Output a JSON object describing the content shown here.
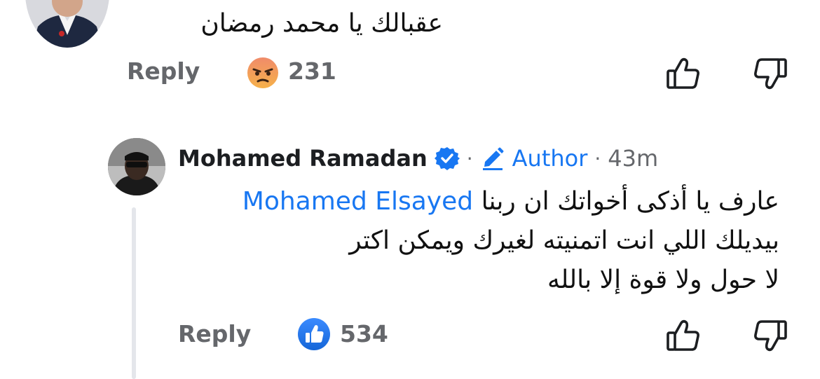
{
  "top_comment": {
    "text": "عقبالك يا محمد رمضان",
    "reply_label": "Reply",
    "reaction_icon": "angry-face-icon",
    "reaction_count": "231"
  },
  "reply_comment": {
    "author": "Mohamed Ramadan",
    "author_badge": "Author",
    "separator": "·",
    "time": "43m",
    "mention": "Mohamed Elsayed",
    "line1_rest": "عارف يا أذكى أخواتك ان ربنا",
    "line2": "بيديلك اللي انت اتمنيته لغيرك ويمكن اكتر",
    "line3": "لا حول ولا قوة إلا بالله",
    "reply_label": "Reply",
    "reaction_icon": "like-icon",
    "reaction_count": "534"
  },
  "colors": {
    "link_blue": "#1877f2",
    "muted_gray": "#65676b",
    "angry_orange": "#f5793a"
  }
}
